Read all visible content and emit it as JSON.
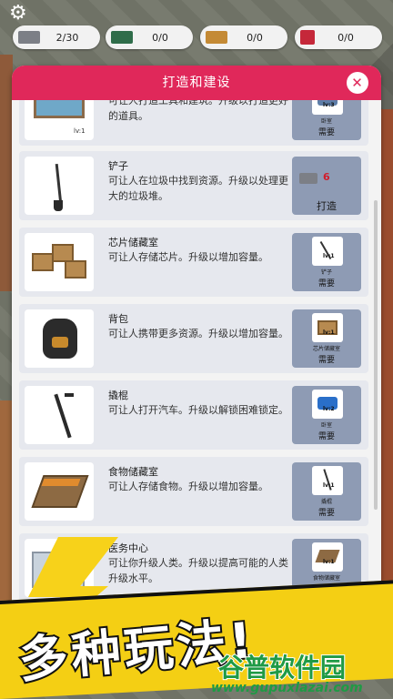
{
  "resources": [
    {
      "icon": "scrap-metal-icon",
      "value": "2/30"
    },
    {
      "icon": "chip-icon",
      "value": "0/0"
    },
    {
      "icon": "food-icon",
      "value": "0/0"
    },
    {
      "icon": "human-icon",
      "value": "0/0"
    }
  ],
  "modal": {
    "title": "打造和建设",
    "close_symbol": "✕"
  },
  "items": [
    {
      "name": "",
      "level": "lv:1",
      "desc": "可让人打造工具和建筑。升级以打造更好的道具。",
      "req_item": "卧室",
      "req_level": "lv:3",
      "req_label": "需要"
    },
    {
      "name": "铲子",
      "desc": "可让人在垃圾中找到资源。升级以处理更大的垃圾堆。",
      "cost": "6",
      "craft_label": "打造"
    },
    {
      "name": "芯片储藏室",
      "desc": "可让人存储芯片。升级以增加容量。",
      "req_item": "铲子",
      "req_level": "lv:1",
      "req_label": "需要"
    },
    {
      "name": "背包",
      "desc": "可让人携带更多资源。升级以增加容量。",
      "req_item": "芯片储藏室",
      "req_level": "lv:1",
      "req_label": "需要"
    },
    {
      "name": "撬棍",
      "desc": "可让人打开汽车。升级以解锁困难锁定。",
      "req_item": "卧室",
      "req_level": "lv:2",
      "req_label": "需要"
    },
    {
      "name": "食物储藏室",
      "desc": "可让人存储食物。升级以增加容量。",
      "req_item": "撬棍",
      "req_level": "lv:1",
      "req_label": "需要"
    },
    {
      "name": "医务中心",
      "desc": "可让你升级人类。升级以提高可能的人类升级水平。",
      "req_item": "食物储藏室",
      "req_level": "lv:1",
      "req_label": "需要"
    }
  ],
  "promo": {
    "headline": "多种玩法!",
    "watermark_name": "谷普软件园",
    "watermark_url": "www.gupuxlazai.com"
  },
  "colors": {
    "header": "#e0285a",
    "card": "#e6e8ee",
    "req_panel": "#8e9bb4",
    "cost": "#d21d2b",
    "banner": "#f4cf14"
  }
}
